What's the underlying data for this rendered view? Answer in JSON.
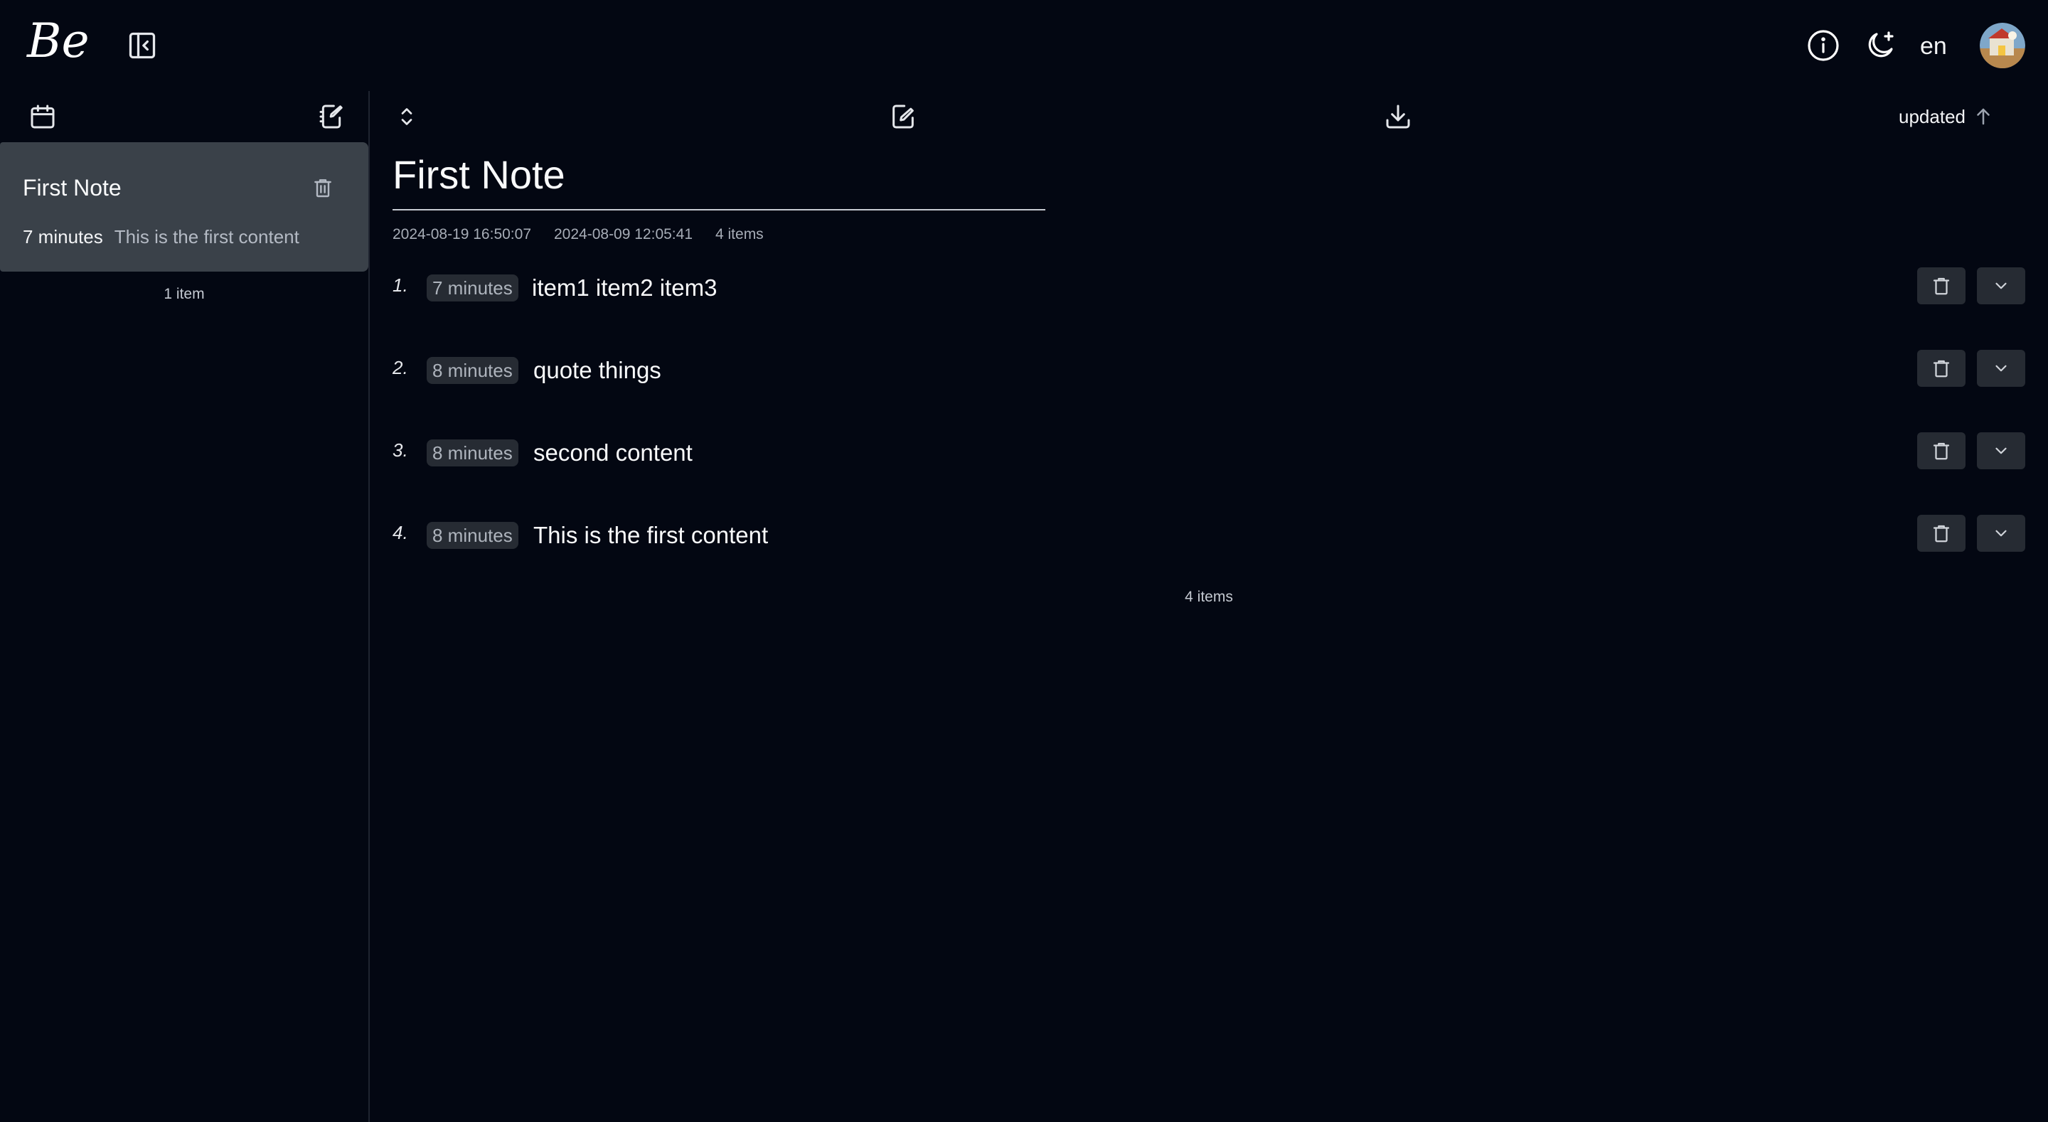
{
  "header": {
    "logo_text": "Be",
    "language": "en"
  },
  "sidebar": {
    "notes": [
      {
        "title": "First Note",
        "time": "7 minutes",
        "preview": "This is the first content"
      }
    ],
    "count_label": "1 item"
  },
  "toolbar": {
    "sort_label": "updated"
  },
  "document": {
    "title": "First Note",
    "updated": "2024-08-19 16:50:07",
    "created": "2024-08-09 12:05:41",
    "items_count": "4 items",
    "entries": [
      {
        "number": "1.",
        "time": "7 minutes",
        "text": "item1 item2 item3"
      },
      {
        "number": "2.",
        "time": "8 minutes",
        "text": "quote things"
      },
      {
        "number": "3.",
        "time": "8 minutes",
        "text": "second content"
      },
      {
        "number": "4.",
        "time": "8 minutes",
        "text": "This is the first content"
      }
    ],
    "footer_count": "4 items"
  },
  "colors": {
    "background": "#030712",
    "selected_note": "#3a4149",
    "badge_bg": "#262b33"
  },
  "icons": [
    "be-logo",
    "sidebar-collapse-icon",
    "info-icon",
    "moon-icon",
    "calendar-icon",
    "new-note-icon",
    "trash-icon",
    "expand-collapse-icon",
    "edit-icon",
    "download-icon",
    "arrow-up-icon",
    "chevron-down-icon"
  ]
}
